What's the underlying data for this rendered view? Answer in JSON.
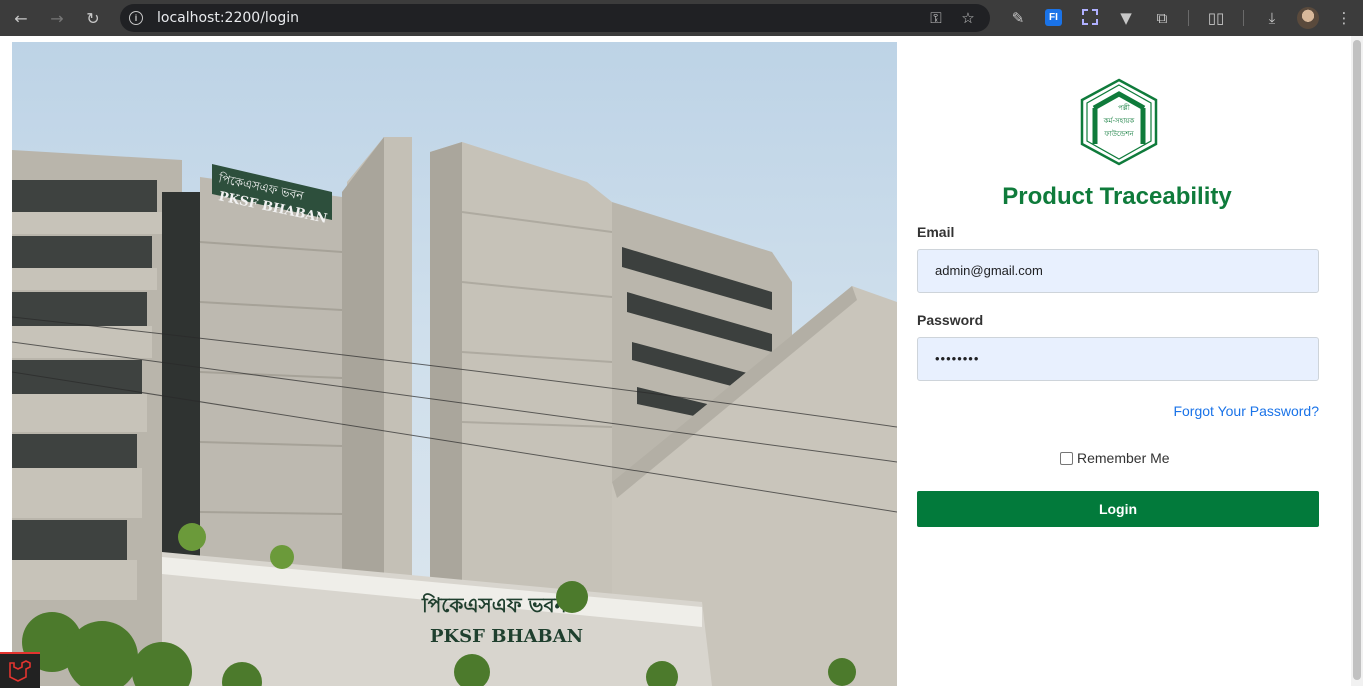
{
  "browser": {
    "url": "localhost:2200/login",
    "extension_label": "FI"
  },
  "login": {
    "title": "Product Traceability",
    "logo_text": [
      "পল্লী",
      "কর্ম-সহায়ক",
      "ফাউন্ডেশন"
    ],
    "email_label": "Email",
    "email_value": "admin@gmail.com",
    "password_label": "Password",
    "password_value": "••••••••",
    "forgot_link": "Forgot Your Password?",
    "remember_label": "Remember Me",
    "login_button": "Login"
  },
  "hero": {
    "sign_top": [
      "পিকেএসএফ ভবন",
      "PKSF BHABAN"
    ],
    "sign_bottom": [
      "পিকেএসএফ ভবন",
      "PKSF BHABAN"
    ]
  },
  "colors": {
    "brand_green": "#0f7b3b",
    "button_green": "#027a3b",
    "link_blue": "#1a73e8",
    "input_fill": "#e8f0fe"
  }
}
